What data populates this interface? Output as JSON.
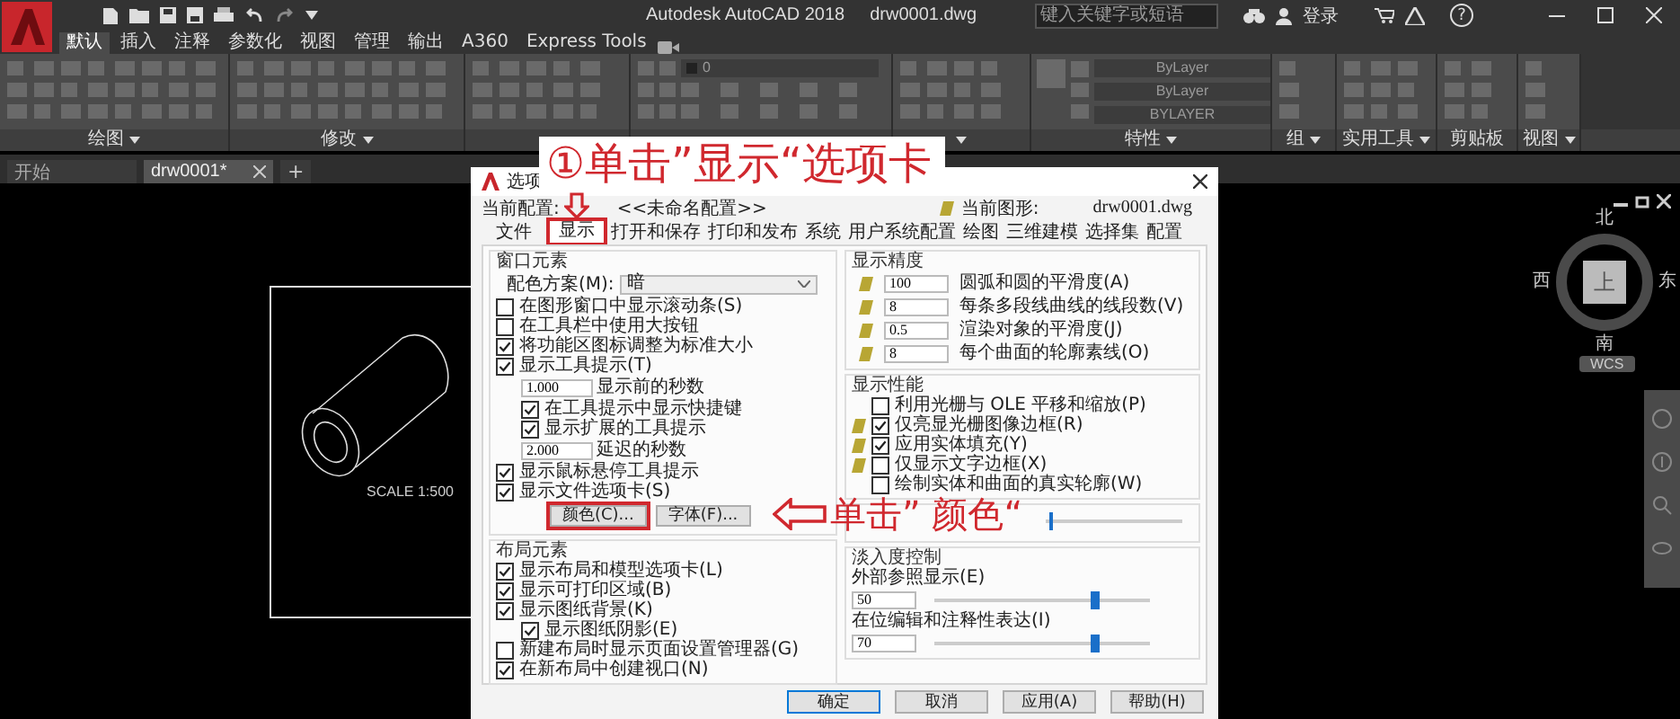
{
  "app": {
    "title": "Autodesk AutoCAD 2018",
    "file": "drw0001.dwg",
    "search_placeholder": "键入关键字或短语",
    "login": "登录",
    "help": "?"
  },
  "ribbon_tabs": [
    {
      "label": "默认",
      "selected": true
    },
    {
      "label": "插入",
      "selected": false
    },
    {
      "label": "注释",
      "selected": false
    },
    {
      "label": "参数化",
      "selected": false
    },
    {
      "label": "视图",
      "selected": false
    },
    {
      "label": "管理",
      "selected": false
    },
    {
      "label": "输出",
      "selected": false
    },
    {
      "label": "A360",
      "selected": false
    },
    {
      "label": "Express Tools",
      "selected": false
    }
  ],
  "ribbon_panels": [
    {
      "kind": "tools",
      "label": "绘图",
      "menu": true
    },
    {
      "kind": "tools",
      "label": "修改",
      "menu": true
    },
    {
      "kind": "tools",
      "menu": false
    },
    {
      "kind": "layers",
      "combo": "0",
      "menu": false
    },
    {
      "kind": "tools",
      "menu": true
    },
    {
      "kind": "properties",
      "label": "特性",
      "menu": true,
      "combos": [
        "ByLayer",
        "ByLayer",
        "BYLAYER"
      ]
    },
    {
      "kind": "tools",
      "label": "组",
      "menu": true
    },
    {
      "kind": "tools",
      "label": "实用工具",
      "menu": true
    },
    {
      "kind": "tools",
      "label": "剪贴板",
      "menu": false
    },
    {
      "kind": "tools",
      "label": "视图",
      "menu": true
    }
  ],
  "file_tabs": [
    {
      "label": "开始",
      "selected": false,
      "closable": false
    },
    {
      "label": "drw0001*",
      "selected": true,
      "closable": true
    }
  ],
  "new_tab": "+",
  "canvas": {
    "scale_note": "SCALE 1:500",
    "compass": {
      "north": "北",
      "south": "南",
      "west": "西",
      "east": "东",
      "top": "上"
    },
    "ucs": "WCS"
  },
  "callouts": {
    "tab_step": "①单击”显示“选项卡",
    "colors_step": "单击” 颜色“"
  },
  "dialog": {
    "title": "选项",
    "profile_label": "当前配置:",
    "profile": "<<未命名配置>>",
    "drawing_label": "当前图形:",
    "drawing": "drw0001.dwg",
    "tabs": [
      {
        "label": "文件",
        "selected": false
      },
      {
        "label": "显示",
        "selected": true
      },
      {
        "label": "打开和保存",
        "selected": false
      },
      {
        "label": "打印和发布",
        "selected": false
      },
      {
        "label": "系统",
        "selected": false
      },
      {
        "label": "用户系统配置",
        "selected": false
      },
      {
        "label": "绘图",
        "selected": false
      },
      {
        "label": "三维建模",
        "selected": false
      },
      {
        "label": "选择集",
        "selected": false
      },
      {
        "label": "配置",
        "selected": false
      }
    ],
    "window_elements": {
      "title": "窗口元素",
      "scheme_label": "配色方案(M):",
      "scheme": "暗",
      "items": [
        {
          "kind": "check",
          "label": "在图形窗口中显示滚动条(S)",
          "checked": false
        },
        {
          "kind": "check",
          "label": "在工具栏中使用大按钮",
          "checked": false
        },
        {
          "kind": "check",
          "label": "将功能区图标调整为标准大小",
          "checked": true
        },
        {
          "kind": "check",
          "label": "显示工具提示(T)",
          "checked": true,
          "children": [
            {
              "kind": "number",
              "value": "1.000",
              "suffix": "显示前的秒数"
            },
            {
              "kind": "check",
              "label": "在工具提示中显示快捷键",
              "checked": true
            },
            {
              "kind": "check",
              "label": "显示扩展的工具提示",
              "checked": true
            },
            {
              "kind": "number",
              "value": "2.000",
              "suffix": "延迟的秒数"
            }
          ]
        },
        {
          "kind": "check",
          "label": "显示鼠标悬停工具提示",
          "checked": true
        },
        {
          "kind": "check",
          "label": "显示文件选项卡(S)",
          "checked": true
        }
      ],
      "buttons": [
        "颜色(C)...",
        "字体(F)..."
      ]
    },
    "layout_elements": {
      "title": "布局元素",
      "items": [
        {
          "kind": "check",
          "label": "显示布局和模型选项卡(L)",
          "checked": true
        },
        {
          "kind": "check",
          "label": "显示可打印区域(B)",
          "checked": true
        },
        {
          "kind": "check",
          "label": "显示图纸背景(K)",
          "checked": true,
          "children": [
            {
              "kind": "check",
              "label": "显示图纸阴影(E)",
              "checked": true
            }
          ]
        },
        {
          "kind": "check",
          "label": "新建布局时显示页面设置管理器(G)",
          "checked": false
        },
        {
          "kind": "check",
          "label": "在新布局中创建视口(N)",
          "checked": true
        }
      ]
    },
    "display_resolution": {
      "title": "显示精度",
      "items": [
        {
          "value": "100",
          "label": "圆弧和圆的平滑度(A)"
        },
        {
          "value": "8",
          "label": "每条多段线曲线的线段数(V)"
        },
        {
          "value": "0.5",
          "label": "渲染对象的平滑度(J)"
        },
        {
          "value": "8",
          "label": "每个曲面的轮廓素线(O)"
        }
      ]
    },
    "display_performance": {
      "title": "显示性能",
      "items": [
        {
          "label": "利用光栅与 OLE 平移和缩放(P)",
          "checked": false,
          "saved_in_drawing": false
        },
        {
          "label": "仅亮显光栅图像边框(R)",
          "checked": true,
          "saved_in_drawing": true
        },
        {
          "label": "应用实体填充(Y)",
          "checked": true,
          "saved_in_drawing": true
        },
        {
          "label": "仅显示文字边框(X)",
          "checked": false,
          "saved_in_drawing": true
        },
        {
          "label": "绘制实体和曲面的真实轮廓(W)",
          "checked": false,
          "saved_in_drawing": false
        }
      ]
    },
    "crosshair": {
      "level": 0.02
    },
    "fade": {
      "title": "淡入度控制",
      "items": [
        {
          "label": "外部参照显示(E)",
          "value": "50",
          "level": 0.74
        },
        {
          "label": "在位编辑和注释性表达(I)",
          "value": "70",
          "level": 0.74
        }
      ]
    },
    "buttons": [
      {
        "label": "确定",
        "default": true
      },
      {
        "label": "取消",
        "default": false
      },
      {
        "label": "应用(A)",
        "default": false
      },
      {
        "label": "帮助(H)",
        "default": false
      }
    ]
  }
}
